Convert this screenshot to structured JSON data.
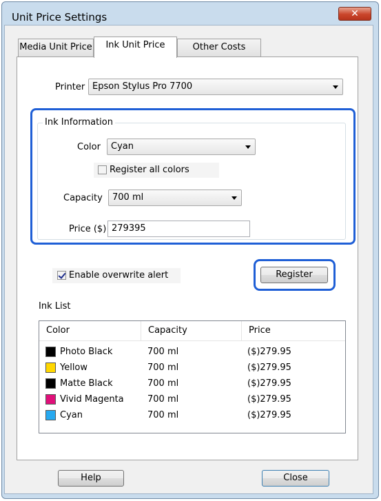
{
  "window": {
    "title": "Unit Price Settings",
    "close_glyph": "✕"
  },
  "tabs": [
    {
      "label": "Media Unit Price"
    },
    {
      "label": "Ink Unit Price"
    },
    {
      "label": "Other Costs"
    }
  ],
  "printer": {
    "label": "Printer",
    "value": "Epson Stylus Pro 7700"
  },
  "ink_information": {
    "group_label": "Ink Information",
    "color_label": "Color",
    "color_value": "Cyan",
    "register_all_label": "Register all colors",
    "register_all_checked": false,
    "capacity_label": "Capacity",
    "capacity_value": "700 ml",
    "price_label": "Price ($)",
    "price_value": "279395"
  },
  "overwrite_alert": {
    "label": "Enable overwrite alert",
    "checked": true
  },
  "register_button": "Register",
  "ink_list": {
    "label": "Ink List",
    "columns": [
      "Color",
      "Capacity",
      "Price"
    ],
    "rows": [
      {
        "color": "Photo Black",
        "swatch": "#000000",
        "capacity": "700 ml",
        "price": "($)279.95"
      },
      {
        "color": "Yellow",
        "swatch": "#ffd700",
        "capacity": "700 ml",
        "price": "($)279.95"
      },
      {
        "color": "Matte Black",
        "swatch": "#000000",
        "capacity": "700 ml",
        "price": "($)279.95"
      },
      {
        "color": "Vivid Magenta",
        "swatch": "#e0107a",
        "capacity": "700 ml",
        "price": "($)279.95"
      },
      {
        "color": "Cyan",
        "swatch": "#27a9f0",
        "capacity": "700 ml",
        "price": "($)279.95"
      }
    ]
  },
  "footer": {
    "help_label": "Help",
    "close_label": "Close"
  },
  "colors": {
    "highlight": "#1f5fd6",
    "window_frame": "#c9dced"
  }
}
